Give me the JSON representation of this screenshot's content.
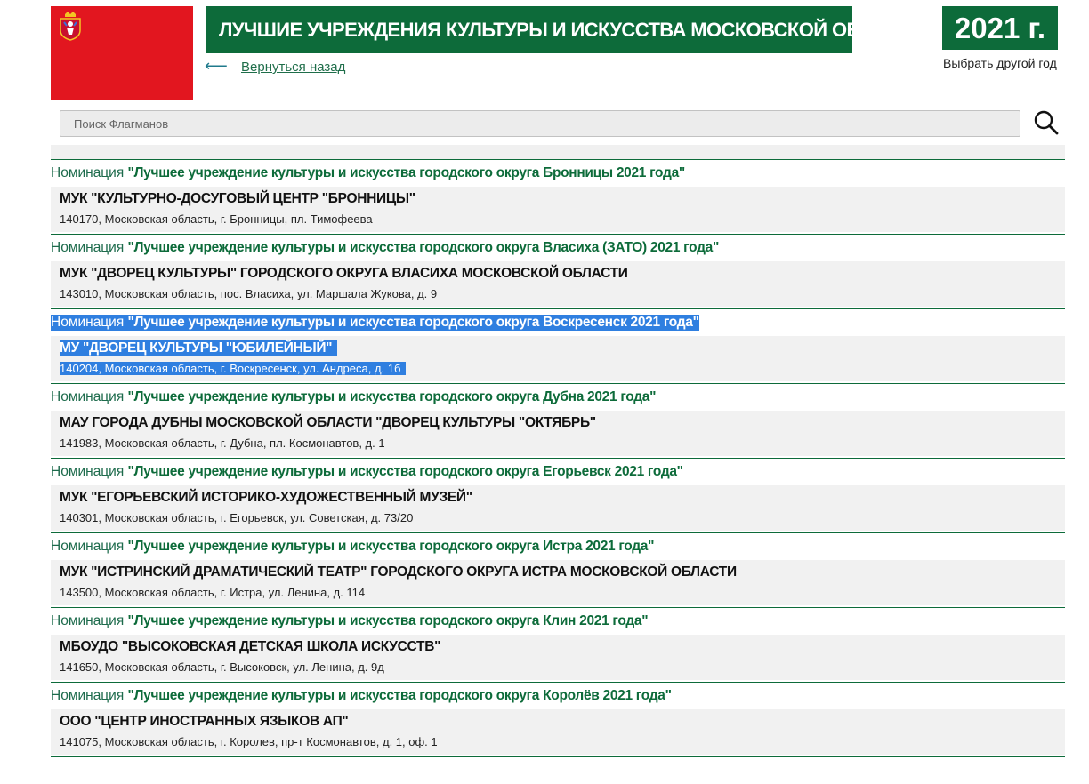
{
  "header": {
    "title": "ЛУЧШИЕ УЧРЕЖДЕНИЯ КУЛЬТУРЫ И ИСКУССТВА МОСКОВСКОЙ ОБЛАСТИ",
    "back_arrow": "⟵",
    "back_link": "Вернуться назад",
    "year": "2021 г.",
    "year_choose": "Выбрать другой год",
    "emblem_icon": "moscow-oblast-coat-of-arms-icon",
    "accent_color": "#0d6b3a",
    "emblem_color": "#e2161f"
  },
  "search": {
    "placeholder": "Поиск Флагманов",
    "value": "",
    "icon": "search-icon"
  },
  "list": {
    "nomination_prefix": "Номинация ",
    "entries": [
      {
        "nomination": "\"Лучшее учреждение культуры и искусства городского округа Бронницы 2021 года\"",
        "org": "МУК \"КУЛЬТУРНО-ДОСУГОВЫЙ ЦЕНТР \"БРОННИЦЫ\"",
        "address": "140170, Московская область, г. Бронницы, пл. Тимофеева",
        "selected": false
      },
      {
        "nomination": "\"Лучшее учреждение культуры и искусства городского округа Власиха (ЗАТО) 2021 года\"",
        "org": "МУК \"ДВОРЕЦ КУЛЬТУРЫ\" ГОРОДСКОГО ОКРУГА ВЛАСИХА МОСКОВСКОЙ ОБЛАСТИ",
        "address": "143010, Московская область, пос. Власиха, ул. Маршала Жукова, д. 9",
        "selected": false
      },
      {
        "nomination": "\"Лучшее учреждение культуры и искусства городского округа Воскресенск 2021 года\"",
        "org": "МУ \"ДВОРЕЦ КУЛЬТУРЫ \"ЮБИЛЕЙНЫЙ\"",
        "address": "140204, Московская область, г. Воскресенск, ул. Андреса, д. 1б",
        "selected": true
      },
      {
        "nomination": "\"Лучшее учреждение культуры и искусства городского округа Дубна 2021 года\"",
        "org": "МАУ ГОРОДА ДУБНЫ МОСКОВСКОЙ ОБЛАСТИ \"ДВОРЕЦ КУЛЬТУРЫ \"ОКТЯБРЬ\"",
        "address": "141983, Московская область, г. Дубна, пл. Космонавтов, д. 1",
        "selected": false
      },
      {
        "nomination": "\"Лучшее учреждение культуры и искусства городского округа Егорьевск 2021 года\"",
        "org": "МУК \"ЕГОРЬЕВСКИЙ ИСТОРИКО-ХУДОЖЕСТВЕННЫЙ МУЗЕЙ\"",
        "address": "140301, Московская область, г. Егорьевск, ул. Советская, д. 73/20",
        "selected": false
      },
      {
        "nomination": "\"Лучшее учреждение культуры и искусства городского округа Истра 2021 года\"",
        "org": "МУК \"ИСТРИНСКИЙ ДРАМАТИЧЕСКИЙ ТЕАТР\" ГОРОДСКОГО ОКРУГА ИСТРА МОСКОВСКОЙ ОБЛАСТИ",
        "address": "143500, Московская область, г. Истра, ул. Ленина, д. 114",
        "selected": false
      },
      {
        "nomination": "\"Лучшее учреждение культуры и искусства городского округа Клин 2021 года\"",
        "org": "МБОУДО \"ВЫСОКОВСКАЯ ДЕТСКАЯ ШКОЛА ИСКУССТВ\"",
        "address": "141650, Московская область, г. Высоковск, ул. Ленина, д. 9д",
        "selected": false
      },
      {
        "nomination": "\"Лучшее учреждение культуры и искусства городского округа Королёв 2021 года\"",
        "org": "ООО \"ЦЕНТР ИНОСТРАННЫХ ЯЗЫКОВ АП\"",
        "address": "141075, Московская область, г. Королев, пр-т Космонавтов, д. 1, оф. 1",
        "selected": false
      }
    ]
  }
}
